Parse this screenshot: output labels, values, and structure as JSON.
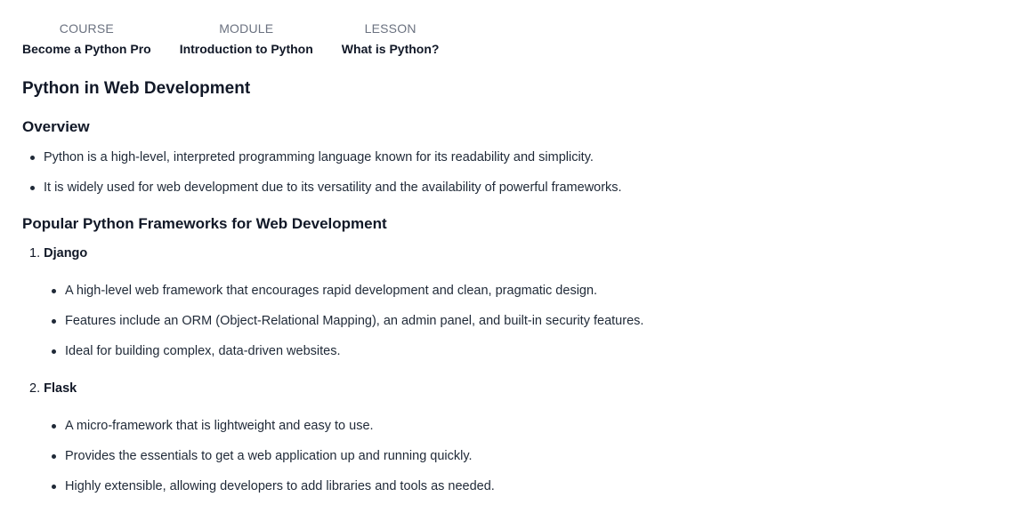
{
  "breadcrumb": {
    "course": {
      "label": "COURSE",
      "value": "Become a Python Pro"
    },
    "module": {
      "label": "MODULE",
      "value": "Introduction to Python"
    },
    "lesson": {
      "label": "LESSON",
      "value": "What is Python?"
    }
  },
  "title": "Python in Web Development",
  "overview": {
    "heading": "Overview",
    "items": [
      "Python is a high-level, interpreted programming language known for its readability and simplicity.",
      "It is widely used for web development due to its versatility and the availability of powerful frameworks."
    ]
  },
  "frameworks": {
    "heading": "Popular Python Frameworks for Web Development",
    "list": [
      {
        "number": "1.",
        "name": "Django",
        "items": [
          "A high-level web framework that encourages rapid development and clean, pragmatic design.",
          "Features include an ORM (Object-Relational Mapping), an admin panel, and built-in security features.",
          "Ideal for building complex, data-driven websites."
        ]
      },
      {
        "number": "2.",
        "name": "Flask",
        "items": [
          "A micro-framework that is lightweight and easy to use.",
          "Provides the essentials to get a web application up and running quickly.",
          "Highly extensible, allowing developers to add libraries and tools as needed."
        ]
      }
    ]
  }
}
